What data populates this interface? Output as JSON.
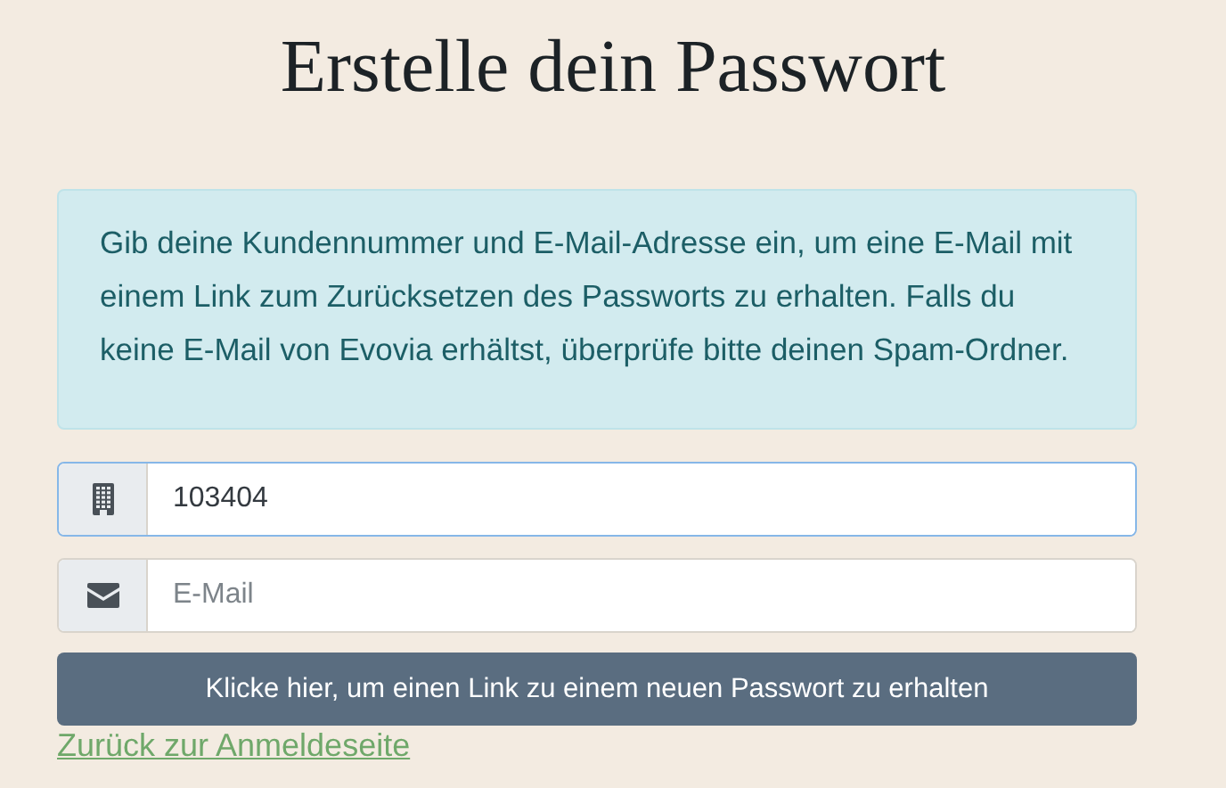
{
  "title": "Erstelle dein Passwort",
  "info": "Gib deine Kundennummer und E-Mail-Adresse ein, um eine E-Mail mit einem Link zum Zurücksetzen des Passworts zu erhalten. Falls du keine E-Mail von Evovia erhältst, überprüfe bitte deinen Spam-Ordner.",
  "fields": [
    {
      "kind": "customer",
      "value": "103404",
      "focused": true
    },
    {
      "kind": "email",
      "placeholder": "E-Mail",
      "focused": false
    }
  ],
  "submit_button": "Klicke hier, um einen Link zu einem neuen Passwort zu erhalten",
  "back_link": "Zurück zur Anmeldeseite"
}
